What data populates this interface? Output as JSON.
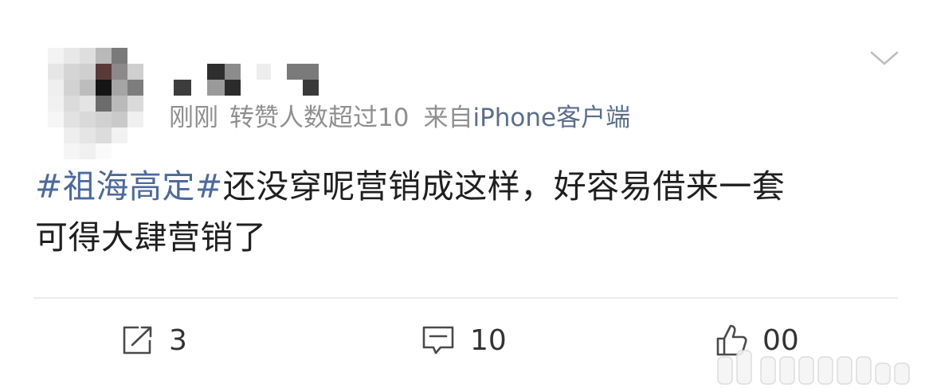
{
  "post": {
    "meta": {
      "time": "刚刚",
      "repost_note": "转赞人数超过10",
      "source_prefix": "来自",
      "source_client": "iPhone客户端"
    },
    "hashtag": "#祖海高定#",
    "text_line1": "还没穿呢营销成这样，好容易借来一套",
    "text_line2": "可得大肆营销了"
  },
  "actions": {
    "repost_count": "3",
    "comment_count": "10",
    "like_count": "00"
  },
  "icons": {
    "dropdown": "chevron-down-icon",
    "repost": "repost-icon",
    "comment": "comment-icon",
    "like": "like-icon"
  },
  "colors": {
    "hashtag": "#4b6a9b",
    "meta": "#8f8f8f",
    "client": "#5a6e8c",
    "text": "#1f1f1f",
    "top_strip": "#ececec"
  }
}
